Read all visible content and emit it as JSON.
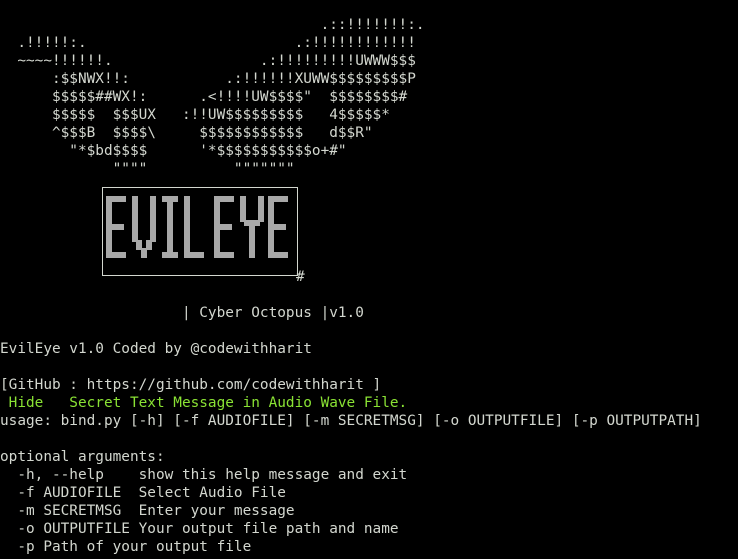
{
  "banner": {
    "ascii_art": [
      "                                     .::!!!!!!!:.",
      "  .!!!!!:.                        .:!!!!!!!!!!!!",
      "  ~~~~!!!!!!.                 .:!!!!!!!!!UWWW$$$",
      "      :$$NWX!!:           .:!!!!!!XUWW$$$$$$$$$P",
      "      $$$$$##WX!:      .<!!!!UW$$$$\"  $$$$$$$$#",
      "      $$$$$  $$$UX   :!!UW$$$$$$$$$   4$$$$$*",
      "      ^$$$B  $$$$\\     $$$$$$$$$$$$   d$$R\"",
      "        \"*$bd$$$$      '*$$$$$$$$$$$o+#\"",
      "             \"\"\"\"          \"\"\"\"\"\"\""
    ],
    "logo_text": "EVIL EYE",
    "logo_hash": "#",
    "tagline": "                     | Cyber Octopus |v1.0"
  },
  "output": {
    "coded_by": "EvilEye v1.0 Coded by @codewithharit",
    "github": "[GitHub : https://github.com/codewithharit ]",
    "hide_line": " Hide   Secret Text Message in Audio Wave File.",
    "usage": "usage: bind.py [-h] [-f AUDIOFILE] [-m SECRETMSG] [-o OUTPUTFILE] [-p OUTPUTPATH]",
    "optional_header": "optional arguments:",
    "arguments": [
      "  -h, --help    show this help message and exit",
      "  -f AUDIOFILE  Select Audio File",
      "  -m SECRETMSG  Enter your message",
      "  -o OUTPUTFILE Your output file path and name",
      "  -p Path of your output file"
    ]
  },
  "colors": {
    "background": "#000000",
    "foreground": "#d3d7cf",
    "accent_green": "#8ae234",
    "logo_gray": "#a8a8a8"
  }
}
